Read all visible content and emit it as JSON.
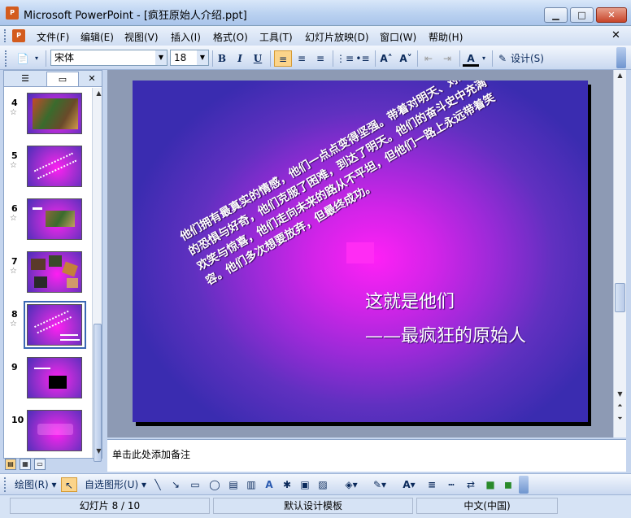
{
  "window": {
    "title": "Microsoft PowerPoint - [疯狂原始人介绍.ppt]",
    "app_icon": "powerpoint-icon",
    "minimize_icon": "▁",
    "maximize_icon": "□",
    "close_icon": "✕"
  },
  "menu": {
    "items": [
      "文件(F)",
      "编辑(E)",
      "视图(V)",
      "插入(I)",
      "格式(O)",
      "工具(T)",
      "幻灯片放映(D)",
      "窗口(W)",
      "帮助(H)"
    ],
    "close_doc": "✕"
  },
  "toolbar": {
    "new_icon": "📄",
    "font_name": "宋体",
    "font_size": "18",
    "bold": "B",
    "italic": "I",
    "underline": "U",
    "grow_font": "A˄",
    "shrink_font": "A˅",
    "font_color": "A",
    "design_label": "设计(S)"
  },
  "left_pane": {
    "tab_outline_icon": "☰",
    "tab_slides_icon": "▭",
    "close": "✕",
    "slides": [
      {
        "number": "4",
        "star": "☆"
      },
      {
        "number": "5",
        "star": "☆"
      },
      {
        "number": "6",
        "star": "☆"
      },
      {
        "number": "7",
        "star": "☆"
      },
      {
        "number": "8",
        "star": "☆",
        "selected": true
      },
      {
        "number": "9",
        "star": ""
      },
      {
        "number": "10",
        "star": ""
      }
    ]
  },
  "slide": {
    "body_text": "他们拥有最真实的情感，他们一点点变得坚强。带着对明天、对未来的恐惧与好奇，他们克服了困难，到达了明天。他们的奋斗史中充满欢笑与惊喜，他们走向未来的路从不平坦，但他们一路上永远带着笑容。他们多次想要放弃，但最终成功。",
    "title_line1": "这就是他们",
    "title_line2": "——最疯狂的原始人"
  },
  "notes": {
    "placeholder": "单击此处添加备注"
  },
  "draw_toolbar": {
    "draw_menu": "绘图(R)",
    "autoshapes_menu": "自选图形(U)"
  },
  "status": {
    "slide_position": "幻灯片 8 / 10",
    "template": "默认设计模板",
    "language": "中文(中国)"
  },
  "colors": {
    "accent_selected": "#3b67b3",
    "slide_center": "#ff20f6",
    "slide_edge": "#3a2cb0"
  }
}
